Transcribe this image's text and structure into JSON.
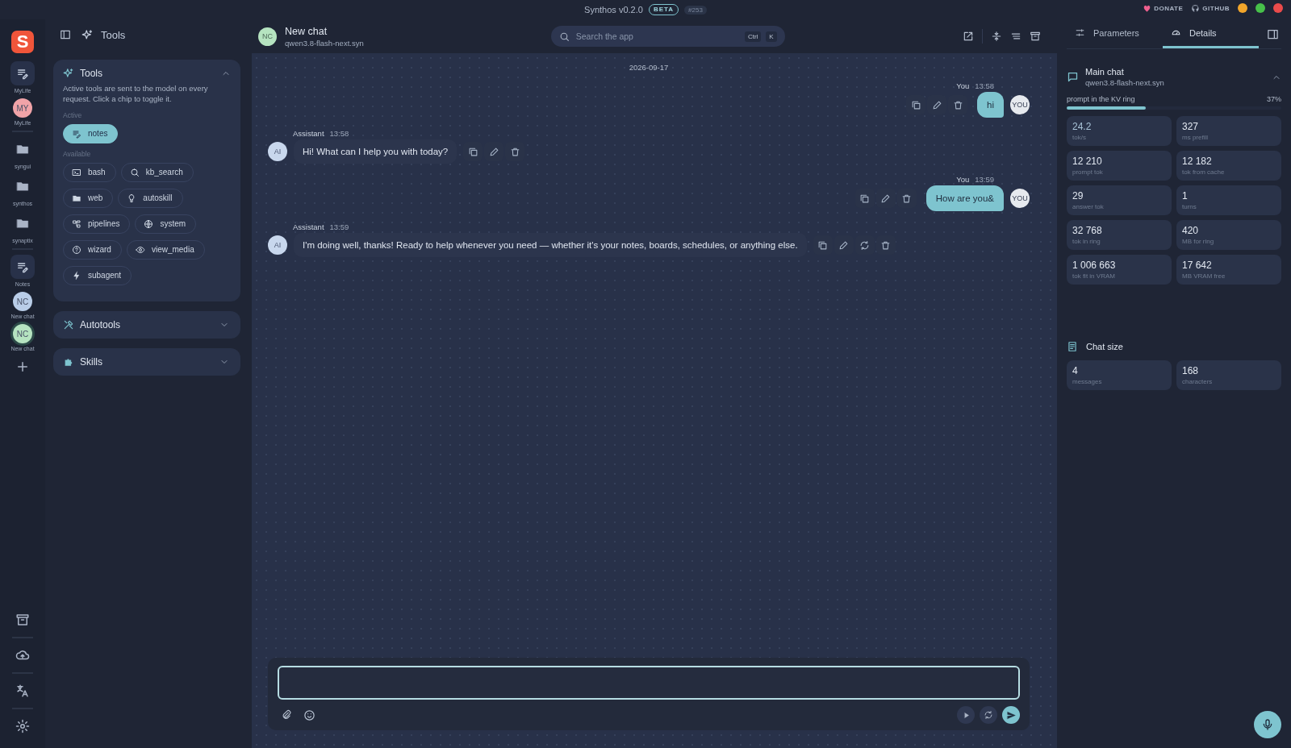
{
  "title_bar": {
    "app_name": "Synthos v0.2.0",
    "badge": "BETA",
    "build": "#253",
    "links": [
      {
        "kind": "donate",
        "label": "DONATE"
      },
      {
        "kind": "github",
        "label": "GITHUB"
      }
    ]
  },
  "rail": {
    "logo": "S",
    "items": [
      {
        "kind": "notes",
        "label": "MyLife",
        "selected": false
      },
      {
        "kind": "avatar",
        "initials": "MY",
        "label": "MyLife",
        "color": "#f0a3a8",
        "selected": false
      },
      {
        "kind": "divider"
      },
      {
        "kind": "folder",
        "label": "syngui",
        "selected": false
      },
      {
        "kind": "folder",
        "label": "synthos",
        "selected": false
      },
      {
        "kind": "folder",
        "label": "synaptix",
        "selected": false
      },
      {
        "kind": "divider"
      },
      {
        "kind": "notes",
        "label": "Notes",
        "selected": false
      },
      {
        "kind": "avatar",
        "initials": "NC",
        "label": "New chat",
        "color": "#b9cde8",
        "selected": false
      },
      {
        "kind": "avatar",
        "initials": "NC",
        "label": "New chat",
        "color": "#b5e3c0",
        "selected": true
      },
      {
        "kind": "add"
      }
    ]
  },
  "sidebar": {
    "title": "Tools",
    "tools_panel": {
      "title": "Tools",
      "expanded": true,
      "description": "Active tools are sent to the model on every request. Click a chip to toggle it.",
      "active_label": "Active",
      "active": [
        {
          "label": "notes"
        }
      ],
      "available_label": "Available",
      "available": [
        {
          "label": "bash"
        },
        {
          "label": "kb_search"
        },
        {
          "label": "web"
        },
        {
          "label": "autoskill"
        },
        {
          "label": "pipelines"
        },
        {
          "label": "system"
        },
        {
          "label": "wizard"
        },
        {
          "label": "view_media"
        },
        {
          "label": "subagent"
        }
      ]
    },
    "sections": [
      {
        "title": "Autotools",
        "expanded": false
      },
      {
        "title": "Skills",
        "expanded": false
      }
    ]
  },
  "chat": {
    "header": {
      "initials": "NC",
      "title": "New chat",
      "model": "qwen3.8-flash-next.syn"
    },
    "search": {
      "placeholder": "Search the app",
      "shortcut": [
        "Ctrl",
        "K"
      ]
    },
    "date": "2026-09-17",
    "messages": [
      {
        "kind": "user",
        "author": "You",
        "time": "13:58",
        "text": "hi",
        "avatar": "YOU",
        "can_regenerate": false
      },
      {
        "kind": "assistant",
        "author": "Assistant",
        "time": "13:58",
        "text": "Hi! What can I help you with today?",
        "avatar": "AI",
        "can_regenerate": false
      },
      {
        "kind": "user",
        "author": "You",
        "time": "13:59",
        "text": "How are you&",
        "avatar": "YOU",
        "can_regenerate": false
      },
      {
        "kind": "assistant",
        "author": "Assistant",
        "time": "13:59",
        "text": "I'm doing well, thanks! Ready to help whenever you need — whether it's your notes, boards, schedules, or anything else.",
        "avatar": "AI",
        "can_regenerate": true
      }
    ]
  },
  "details": {
    "tabs": [
      {
        "label": "Parameters",
        "selected": false
      },
      {
        "label": "Details",
        "selected": true
      }
    ],
    "main_chat": {
      "title": "Main chat",
      "model": "qwen3.8-flash-next.syn",
      "expanded": true,
      "ring_label": "prompt in the KV ring",
      "ring_percent": "37%",
      "level": 0.37,
      "stats": [
        {
          "value": "24.2",
          "label": "tok/s",
          "highlight": true
        },
        {
          "value": "327",
          "label": "ms prefill",
          "highlight": false
        },
        {
          "value": "12 210",
          "label": "prompt tok",
          "highlight": false
        },
        {
          "value": "12 182",
          "label": "tok from cache",
          "highlight": false
        },
        {
          "value": "29",
          "label": "answer tok",
          "highlight": false
        },
        {
          "value": "1",
          "label": "turns",
          "highlight": false
        },
        {
          "value": "32 768",
          "label": "tok in ring",
          "highlight": false
        },
        {
          "value": "420",
          "label": "MB for ring",
          "highlight": false
        },
        {
          "value": "1 006 663",
          "label": "tok fit in VRAM",
          "highlight": false
        },
        {
          "value": "17 642",
          "label": "MB VRAM free",
          "highlight": false
        }
      ]
    },
    "chat_size": {
      "title": "Chat size",
      "stats": [
        {
          "value": "4",
          "label": "messages"
        },
        {
          "value": "168",
          "label": "characters"
        }
      ]
    }
  }
}
